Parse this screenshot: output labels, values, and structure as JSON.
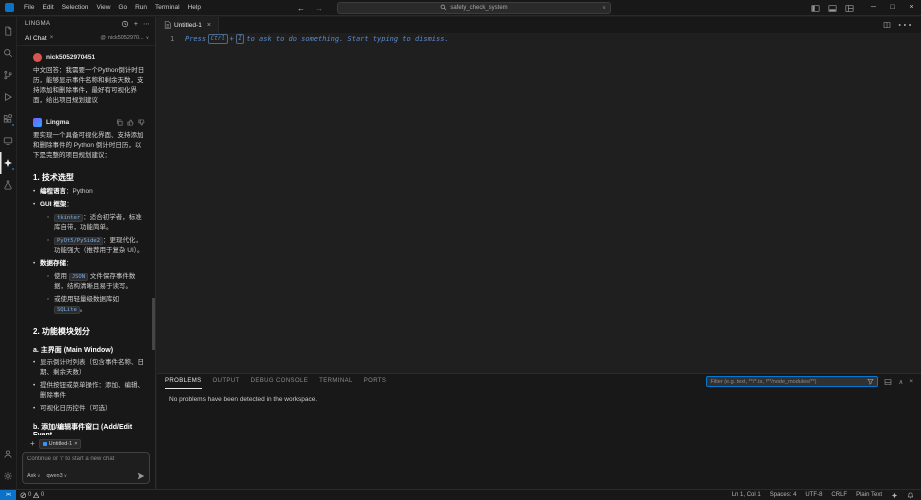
{
  "colors": {
    "accent": "#0078d4",
    "shell_bg": "#181818",
    "editor_bg": "#1f1f1f",
    "ghost_text": "#5a8bd0",
    "user_avatar": "#d95550",
    "remote_indicator": "#0a72c9",
    "code_chip_text": "#79b0e8"
  },
  "icons": {
    "back_arrow": "←",
    "forward_arrow": "→",
    "minimize": "─",
    "maximize": "□",
    "close": "×",
    "ellipsis": "⋯",
    "chevron_down": "∨",
    "chevron_up": "∧",
    "plus": "+",
    "at_sign": "@",
    "remote": "><",
    "close_small": "×"
  },
  "title_bar": {
    "menus": [
      "File",
      "Edit",
      "Selection",
      "View",
      "Go",
      "Run",
      "Terminal",
      "Help"
    ],
    "search_value": "safety_check_system"
  },
  "sidebar": {
    "title": "LINGMA",
    "tab_label": "AI Chat",
    "account_name": "nick5052970...",
    "user_name": "nick5052970451",
    "user_message": "中文回答：我需要一个Python倒计时日历，能够显示事件名称和剩余天数，支持添加和删除事件，最好有可视化界面，给出项目规划建议",
    "assistant_name": "Lingma",
    "assistant_intro": "要实现一个具备可视化界面、支持添加和删除事件的 Python 倒计时日历，以下是完整的项目规划建议：",
    "s1_title": "1. 技术选型",
    "s1_b1_label": "编程语言",
    "s1_b1_text": "：Python",
    "s1_b2_label": "GUI 框架",
    "s1_b2_text": "：",
    "s1_b2_o1_code": "tkinter",
    "s1_b2_o1_text": "：适合初学者，标准库自带，功能简单。",
    "s1_b2_o2_code": "PyQt5/PySide2",
    "s1_b2_o2_text": "：更现代化，功能强大（推荐用于复杂 UI）。",
    "s1_b3_label": "数据存储",
    "s1_b3_text": "：",
    "s1_b3_o1_pre": "使用 ",
    "s1_b3_o1_code": "JSON",
    "s1_b3_o1_post": " 文件保存事件数据，结构清晰且易于读写。",
    "s1_b3_o2_pre": "或使用轻量级数据库如 ",
    "s1_b3_o2_code": "SQLite",
    "s1_b3_o2_post": "。",
    "s2_title": "2. 功能模块划分",
    "s2_a_title": "a. 主界面 (Main Window)",
    "s2_a_b1": "显示倒计时列表（包含事件名称、日期、剩余天数）",
    "s2_a_b2": "提供按钮或菜单操作：添加、编辑、删除事件",
    "s2_a_b3": "可视化日历控件（可选）",
    "s2_b_title": "b. 添加/编辑事件窗口 (Add/Edit Event",
    "chat_tab_label": "Untitled-1",
    "chat_placeholder": "Continue or '/' to start a new chat",
    "mode_label": "Ask",
    "model_label": "qwen3"
  },
  "editor": {
    "tab_label": "Untitled-1",
    "line_number": "1",
    "hint_before": "Press",
    "hint_key_1": "Ctrl",
    "hint_key_join": "+",
    "hint_key_2": "I",
    "hint_after": "to ask to do something. Start typing to dismiss."
  },
  "panel": {
    "tabs": [
      "PROBLEMS",
      "OUTPUT",
      "DEBUG CONSOLE",
      "TERMINAL",
      "PORTS"
    ],
    "filter_placeholder": "Filter (e.g. text, **/*.ts, !**/node_modules/**)",
    "empty_message": "No problems have been detected in the workspace."
  },
  "status_bar": {
    "error_count": "0",
    "warning_count": "0",
    "cursor_position": "Ln 1, Col 1",
    "indentation": "Spaces: 4",
    "encoding": "UTF-8",
    "eol": "CRLF",
    "language_mode": "Plain Text"
  }
}
